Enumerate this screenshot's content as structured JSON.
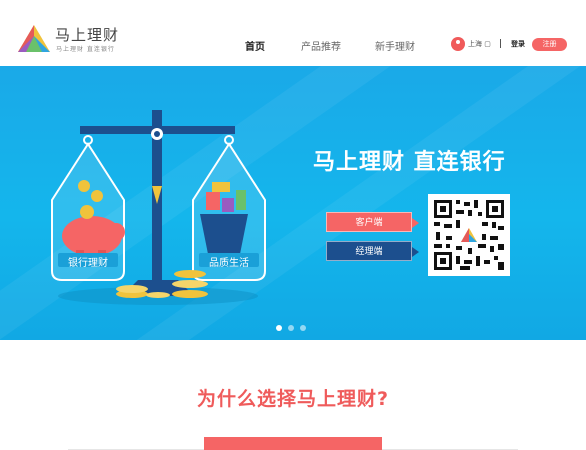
{
  "header": {
    "brand_name": "马上理财",
    "brand_tagline": "马上理财 直连银行",
    "nav": [
      {
        "label": "首页",
        "active": true
      },
      {
        "label": "产品推荐",
        "active": false
      },
      {
        "label": "新手理财",
        "active": false
      }
    ],
    "location": "上海",
    "login_label": "登录",
    "register_label": "注册"
  },
  "banner": {
    "headline": "马上理财  直连银行",
    "client_button": "客户端",
    "manager_button": "经理端",
    "left_pan_label": "银行理财",
    "right_pan_label": "品质生活",
    "slides": 3,
    "active_slide": 1
  },
  "section": {
    "title": "为什么选择马上理财?"
  },
  "colors": {
    "accent": "#f56565",
    "banner": "#14b6ec",
    "navy": "#1c4f8e"
  }
}
